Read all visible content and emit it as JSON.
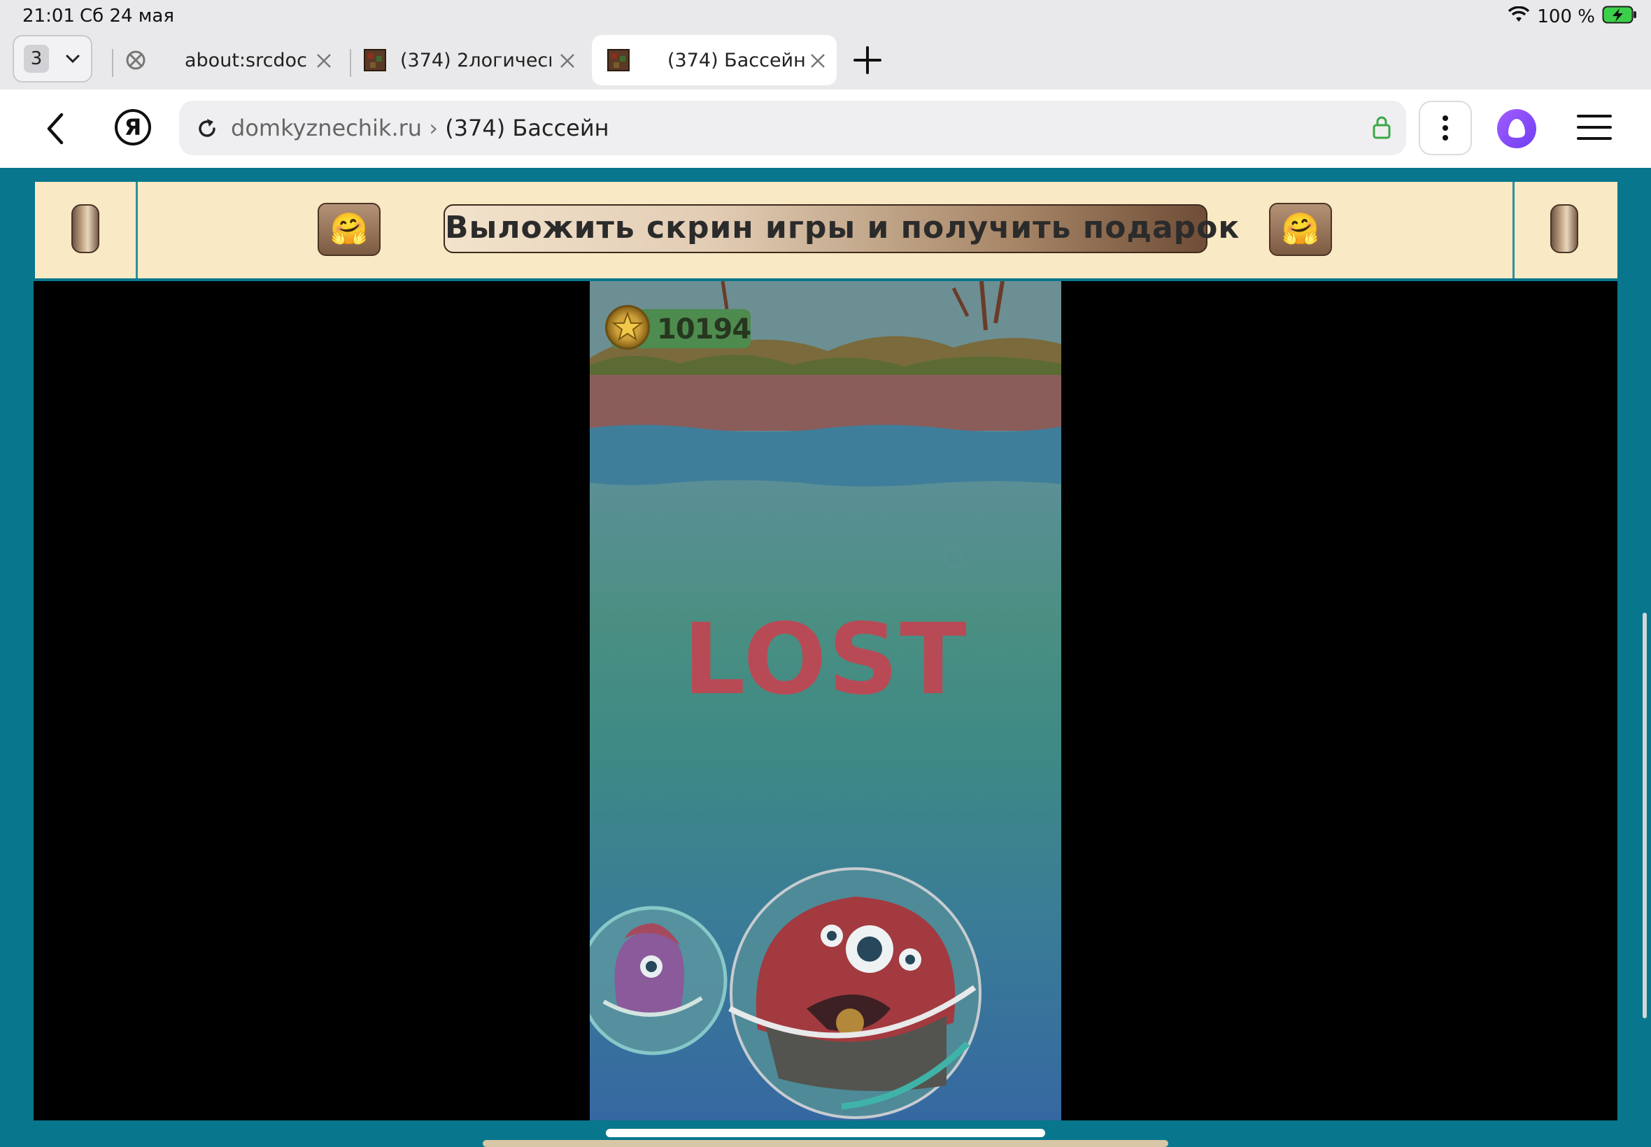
{
  "status_bar": {
    "time": "21:01",
    "date": "Сб 24 мая",
    "battery": "100 %",
    "icons": [
      "wifi-icon",
      "battery-charging-icon"
    ]
  },
  "tabs": {
    "count": "3",
    "items": [
      {
        "title": "about:srcdoc",
        "favicon": "blocked-icon",
        "active": false
      },
      {
        "title": "(374) 2логическ...",
        "favicon": "site-favicon",
        "active": false
      },
      {
        "title": "(374) Бассейн",
        "favicon": "site-favicon",
        "active": true
      }
    ]
  },
  "address_bar": {
    "host": "domkyznechik.ru",
    "separator": "›",
    "page_title": "(374) Бассейн",
    "icons": [
      "back-icon",
      "yandex-logo-icon",
      "reload-icon",
      "lock-icon",
      "more-vertical-icon",
      "alice-icon",
      "menu-icon"
    ]
  },
  "site": {
    "promo_button": "Выложить скрин игры и получить подарок",
    "emoji": "🤗"
  },
  "game": {
    "score": "10194",
    "status": "LOST"
  },
  "colors": {
    "page_bg": "#08768c",
    "banner_bg": "#f9e9c4",
    "lost_text": "#b84a55",
    "accent_alice": "#7b4cf6"
  }
}
